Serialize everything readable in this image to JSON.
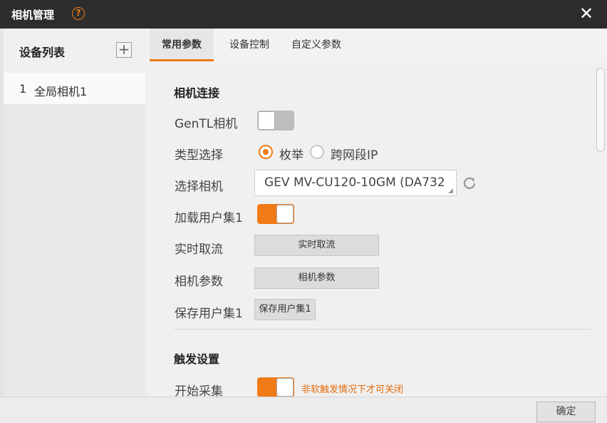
{
  "window": {
    "title": "相机管理",
    "help_glyph": "?",
    "close_glyph": "✕"
  },
  "sidebar": {
    "header_label": "设备列表",
    "add_glyph": "+",
    "items": [
      {
        "index": "1",
        "name": "全局相机1"
      }
    ]
  },
  "tabs": [
    {
      "label": "常用参数",
      "active": true
    },
    {
      "label": "设备控制",
      "active": false
    },
    {
      "label": "自定义参数",
      "active": false
    }
  ],
  "connection": {
    "section_title": "相机连接",
    "gentl_label": "GenTL相机",
    "gentl_on": false,
    "type_label": "类型选择",
    "type_options": [
      {
        "label": "枚举",
        "selected": true
      },
      {
        "label": "跨网段IP",
        "selected": false
      }
    ],
    "select_camera_label": "选择相机",
    "select_camera_value": "GEV MV-CU120-10GM (DA732",
    "load_userset_label": "加载用户集1",
    "load_userset_on": true,
    "live_label": "实时取流",
    "live_button": "实时取流",
    "params_label": "相机参数",
    "params_button": "相机参数",
    "save_userset_label": "保存用户集1",
    "save_userset_button": "保存用户集1"
  },
  "trigger": {
    "section_title": "触发设置",
    "start_label": "开始采集",
    "start_on": true,
    "start_hint": "非软触发情况下才可关闭"
  },
  "footer": {
    "ok_label": "确定"
  },
  "colors": {
    "accent": "#f07a17",
    "titlebar": "#2d2d2d",
    "background": "#f0f0f0"
  }
}
